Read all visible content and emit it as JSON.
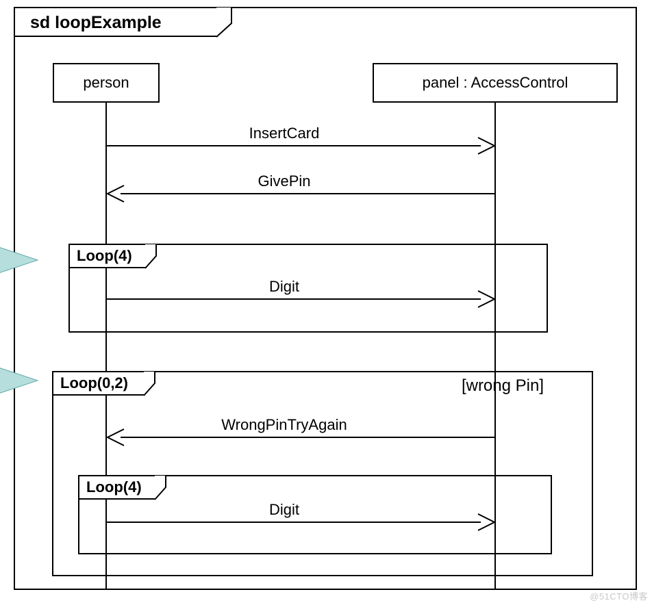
{
  "diagram": {
    "title": "sd loopExample",
    "lifelines": {
      "person": "person",
      "panel": "panel : AccessControl"
    },
    "messages": {
      "m1": "InsertCard",
      "m2": "GivePin",
      "m3": "Digit",
      "m4": "WrongPinTryAgain",
      "m5": "Digit"
    },
    "loops": {
      "l1": {
        "label": "Loop(4)"
      },
      "l2": {
        "label": "Loop(0,2)",
        "guard": "[wrong Pin]"
      },
      "l3": {
        "label": "Loop(4)"
      }
    }
  },
  "watermark": "@51CTO博客"
}
